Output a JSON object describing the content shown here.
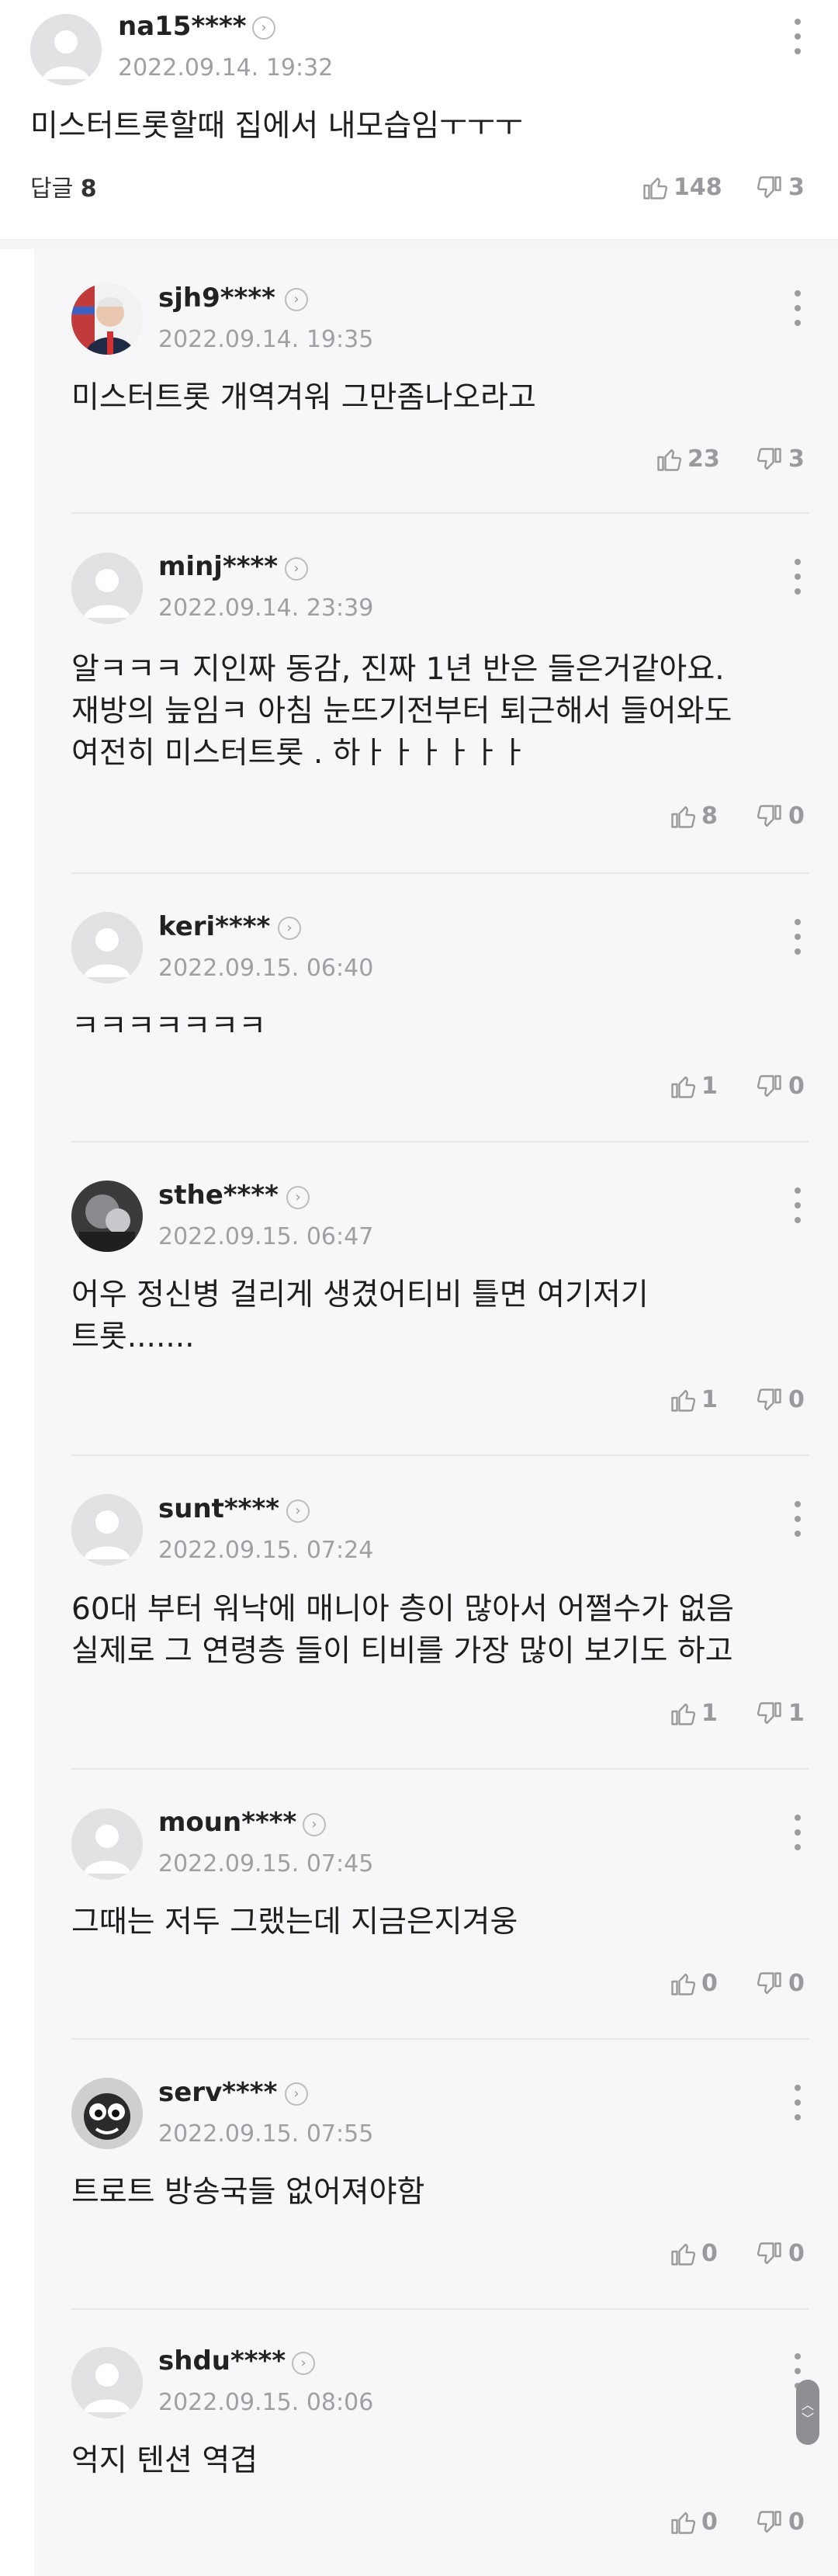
{
  "main_comment": {
    "username": "na15****",
    "date": "2022.09.14. 19:32",
    "text": "미스터트롯할때 집에서 내모습임ㅜㅜㅜ",
    "reply_label": "답글",
    "reply_count": "8",
    "likes": "148",
    "dislikes": "3",
    "avatar": "default-avatar-icon"
  },
  "replies": [
    {
      "username": "sjh9****",
      "date": "2022.09.14. 19:35",
      "text": "미스터트롯 개역겨워 그만좀나오라고",
      "likes": "23",
      "dislikes": "3",
      "avatar": "photo-avatar"
    },
    {
      "username": "minj****",
      "date": "2022.09.14. 23:39",
      "text": "알ㅋㅋㅋ 지인짜 동감, 진짜 1년 반은 들은거같아요. 재방의 늪임ㅋ 아침 눈뜨기전부터 퇴근해서 들어와도 여전히 미스터트롯 . 하ㅏㅏㅏㅏㅏㅏ",
      "likes": "8",
      "dislikes": "0",
      "avatar": "default-avatar-icon"
    },
    {
      "username": "keri****",
      "date": "2022.09.15. 06:40",
      "text": "ㅋㅋㅋㅋㅋㅋㅋ",
      "likes": "1",
      "dislikes": "0",
      "avatar": "default-avatar-icon"
    },
    {
      "username": "sthe****",
      "date": "2022.09.15. 06:47",
      "text": "어우 정신병 걸리게 생겼어티비 틀면 여기저기 트롯.......",
      "likes": "1",
      "dislikes": "0",
      "avatar": "photo-avatar"
    },
    {
      "username": "sunt****",
      "date": "2022.09.15. 07:24",
      "text": "60대 부터 워낙에 매니아 층이 많아서 어쩔수가 없음 실제로 그 연령층 들이 티비를 가장 많이 보기도 하고",
      "likes": "1",
      "dislikes": "1",
      "avatar": "default-avatar-icon"
    },
    {
      "username": "moun****",
      "date": "2022.09.15. 07:45",
      "text": "그때는 저두 그랬는데 지금은지겨웅",
      "likes": "0",
      "dislikes": "0",
      "avatar": "default-avatar-icon"
    },
    {
      "username": "serv****",
      "date": "2022.09.15. 07:55",
      "text": "트로트 방송국들 없어져야함",
      "likes": "0",
      "dislikes": "0",
      "avatar": "cartoon-avatar"
    },
    {
      "username": "shdu****",
      "date": "2022.09.15. 08:06",
      "text": "억지 텐션 역겹",
      "likes": "0",
      "dislikes": "0",
      "avatar": "default-avatar-icon"
    }
  ],
  "colors": {
    "background": "#ffffff",
    "reply_background": "#f7f7f9",
    "muted_text": "#a0a0a4",
    "body_text": "#1e1e1e"
  }
}
